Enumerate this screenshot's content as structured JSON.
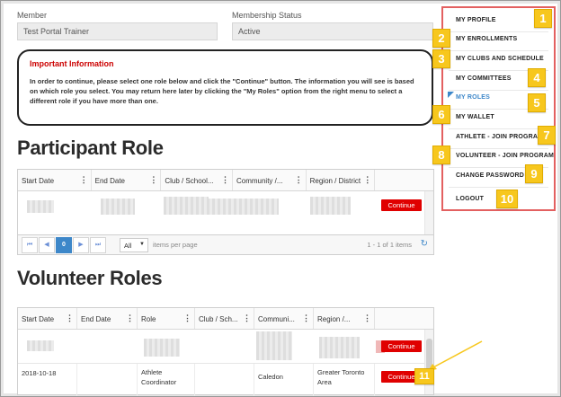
{
  "member": {
    "label": "Member",
    "value": "Test Portal Trainer"
  },
  "membership_status": {
    "label": "Membership Status",
    "value": "Active"
  },
  "info": {
    "title": "Important Information",
    "text": "In order to continue, please select one role below and click the \"Continue\" button. The information you will see is based on which role you select. You may return here later by clicking the \"My Roles\" option from the right menu to select a different role if you have more than one."
  },
  "participant": {
    "title": "Participant Role",
    "columns": [
      "Start Date",
      "End Date",
      "Club / School...",
      "Community /...",
      "Region / District"
    ],
    "continue_label": "Continue",
    "pager": {
      "first": "⏮",
      "prev": "◀",
      "page": "0",
      "next": "▶",
      "last": "⏭",
      "page_size": "All",
      "items_per_page": "items per page",
      "summary": "1 - 1 of 1 items"
    }
  },
  "volunteer": {
    "title": "Volunteer Roles",
    "columns": [
      "Start Date",
      "End Date",
      "Role",
      "Club / Sch...",
      "Communi...",
      "Region /...",
      ""
    ],
    "continue_label": "Continue",
    "row2": {
      "start": "2018-10-18",
      "role": "Athlete Coordinator",
      "community": "Caledon",
      "region": "Greater Toronto Area"
    }
  },
  "menu": [
    {
      "label": "MY PROFILE",
      "badge": "1"
    },
    {
      "label": "MY ENROLLMENTS",
      "badge": "2"
    },
    {
      "label": "MY CLUBS AND SCHEDULE",
      "badge": "3"
    },
    {
      "label": "MY COMMITTEES",
      "badge": "4"
    },
    {
      "label": "MY ROLES",
      "badge": "5"
    },
    {
      "label": "MY WALLET",
      "badge": "6"
    },
    {
      "label": "ATHLETE - JOIN PROGRAM",
      "badge": "7"
    },
    {
      "label": "VOLUNTEER - JOIN PROGRAM",
      "badge": "8"
    },
    {
      "label": "CHANGE PASSWORD",
      "badge": "9"
    },
    {
      "label": "LOGOUT",
      "badge": "10"
    }
  ],
  "continue_badge": "11",
  "colors": {
    "accent": "#3d87c9",
    "danger": "#e00000",
    "badge": "#f7c71d",
    "menu_border": "#e36060"
  }
}
